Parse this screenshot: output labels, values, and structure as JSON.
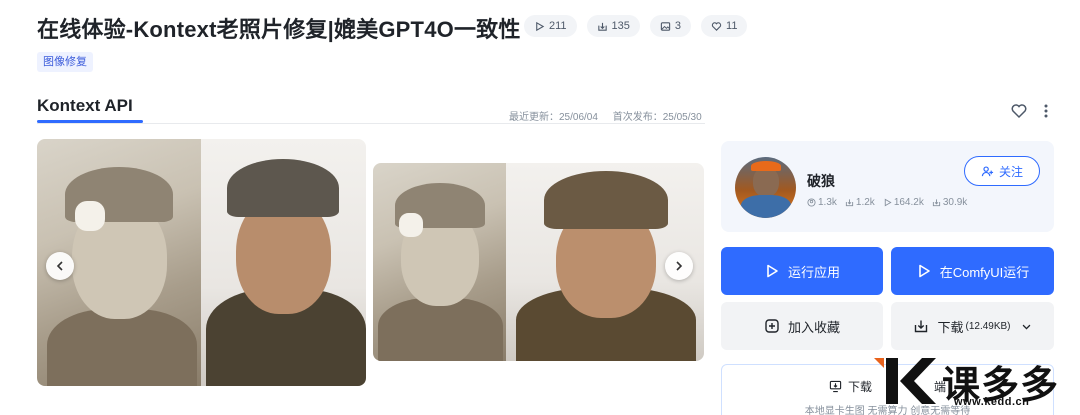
{
  "header": {
    "title": "在线体验-Kontext老照片修复|媲美GPT4O一致性",
    "stats": [
      {
        "icon": "play-icon",
        "value": "211"
      },
      {
        "icon": "download-icon",
        "value": "135"
      },
      {
        "icon": "image-icon",
        "value": "3"
      },
      {
        "icon": "heart-icon",
        "value": "11"
      }
    ],
    "tag": "图像修复"
  },
  "section": {
    "title": "Kontext API",
    "last_updated": "最近更新：25/06/04",
    "first_published": "首次发布：25/05/30"
  },
  "author": {
    "name": "破狼",
    "follow_label": "关注",
    "stats": [
      {
        "icon": "user-icon",
        "value": "1.3k"
      },
      {
        "icon": "run-icon",
        "value": "1.2k"
      },
      {
        "icon": "play-icon",
        "value": "164.2k"
      },
      {
        "icon": "download-icon",
        "value": "30.9k"
      }
    ]
  },
  "actions": {
    "run_app": "运行应用",
    "run_comfyui": "在ComfyUI运行",
    "add_favorite": "加入收藏",
    "download": "下载",
    "download_size": "(12.49KB)",
    "download_client": "下载",
    "download_client_tail": "端",
    "download_client_sub": "本地显卡生图 无需算力 创意无需等待"
  },
  "watermark": {
    "brand": "课多多",
    "url": "www.kedd.cn"
  },
  "colors": {
    "accent": "#2f6bff",
    "tag_bg": "#eef2ff"
  }
}
